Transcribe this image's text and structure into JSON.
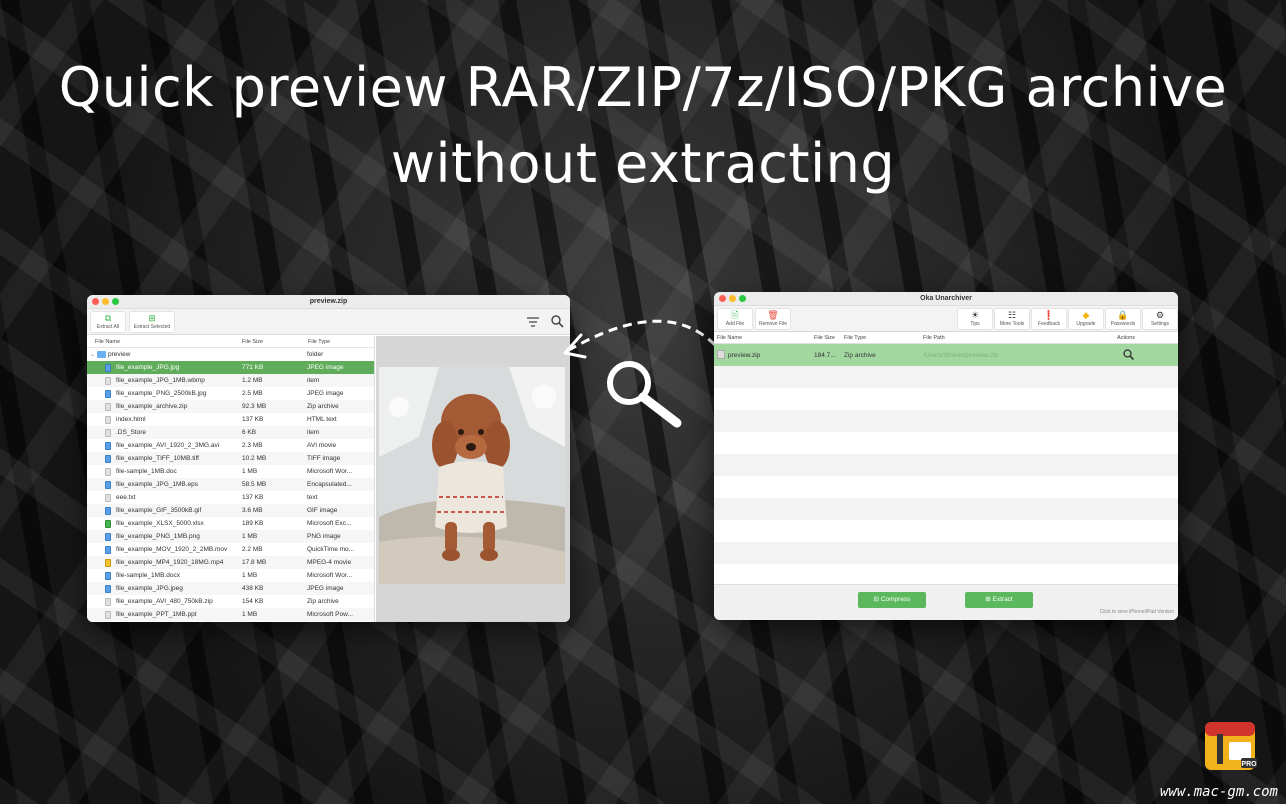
{
  "headline": {
    "line1": "Quick preview RAR/ZIP/7z/ISO/PKG archive",
    "line2": "without extracting"
  },
  "preview_window": {
    "title": "preview.zip",
    "toolbar": {
      "extract_all": "Extract All",
      "extract_selected": "Extract Selected"
    },
    "columns": {
      "name": "File Name",
      "size": "File Size",
      "type": "File Type"
    },
    "folder": {
      "name": "preview",
      "size": "",
      "type": "folder"
    },
    "files": [
      {
        "name": "file_example_JPG.jpg",
        "size": "771 KB",
        "type": "JPEG image",
        "icon": "blue"
      },
      {
        "name": "file_example_JPG_1MB.wbmp",
        "size": "1.2 MB",
        "type": "item",
        "icon": "plain"
      },
      {
        "name": "file_example_PNG_2500kB.jpg",
        "size": "2.5 MB",
        "type": "JPEG image",
        "icon": "blue"
      },
      {
        "name": "file_example_archive.zip",
        "size": "92.3 MB",
        "type": "Zip archive",
        "icon": "plain"
      },
      {
        "name": "index.html",
        "size": "137 KB",
        "type": "HTML text",
        "icon": "plain"
      },
      {
        "name": ".DS_Store",
        "size": "6 KB",
        "type": "item",
        "icon": "plain"
      },
      {
        "name": "file_example_AVI_1920_2_3MG.avi",
        "size": "2.3 MB",
        "type": "AVI movie",
        "icon": "blue"
      },
      {
        "name": "file_example_TIFF_10MB.tiff",
        "size": "10.2 MB",
        "type": "TIFF image",
        "icon": "blue"
      },
      {
        "name": "file-sample_1MB.doc",
        "size": "1 MB",
        "type": "Microsoft Wor...",
        "icon": "plain"
      },
      {
        "name": "file_example_JPG_1MB.eps",
        "size": "58.5 MB",
        "type": "Encapsulated...",
        "icon": "blue"
      },
      {
        "name": "eee.txt",
        "size": "137 KB",
        "type": "text",
        "icon": "plain"
      },
      {
        "name": "file_example_GIF_3500kB.gif",
        "size": "3.6 MB",
        "type": "GIF image",
        "icon": "blue"
      },
      {
        "name": "file_example_XLSX_5000.xlsx",
        "size": "189 KB",
        "type": "Microsoft Exc...",
        "icon": "green"
      },
      {
        "name": "file_example_PNG_1MB.png",
        "size": "1 MB",
        "type": "PNG image",
        "icon": "blue"
      },
      {
        "name": "file_example_MOV_1920_2_2MB.mov",
        "size": "2.2 MB",
        "type": "QuickTime mo...",
        "icon": "blue"
      },
      {
        "name": "file_example_MP4_1920_18MG.mp4",
        "size": "17.8 MB",
        "type": "MPEG-4 movie",
        "icon": "yellow"
      },
      {
        "name": "file-sample_1MB.docx",
        "size": "1 MB",
        "type": "Microsoft Wor...",
        "icon": "blue"
      },
      {
        "name": "file_example_JPG.jpeg",
        "size": "438 KB",
        "type": "JPEG image",
        "icon": "blue"
      },
      {
        "name": "file_example_AVI_480_750kB.zip",
        "size": "154 KB",
        "type": "Zip archive",
        "icon": "plain"
      },
      {
        "name": "file_example_PPT_1MB.ppt",
        "size": "1 MB",
        "type": "Microsoft Pow...",
        "icon": "plain"
      }
    ]
  },
  "main_window": {
    "title": "Oka Unarchiver",
    "toolbar": {
      "add_file": "Add File",
      "remove_file": "Remove File",
      "tips": "Tips",
      "more_tools": "More Tools",
      "feedback": "Feedback",
      "upgrade": "Upgrade",
      "passwords": "Passwords",
      "settings": "Settings"
    },
    "columns": {
      "name": "File Name",
      "size": "File Size",
      "type": "File Type",
      "path": "File Path",
      "actions": "Actions"
    },
    "row": {
      "name": "preview.zip",
      "size": "184.7...",
      "type": "Zip archive",
      "path": "/Users/Shared/preview.zip"
    },
    "compress": "Compress",
    "extract": "Extract",
    "hint": "Click to view iPhone/iPad Version"
  },
  "watermark": "www.mac-gm.com",
  "badge": "PRO",
  "colors": {
    "accent_green": "#5cb85c",
    "selection_green": "#5fad5a",
    "row_green": "#a3d7a0"
  }
}
